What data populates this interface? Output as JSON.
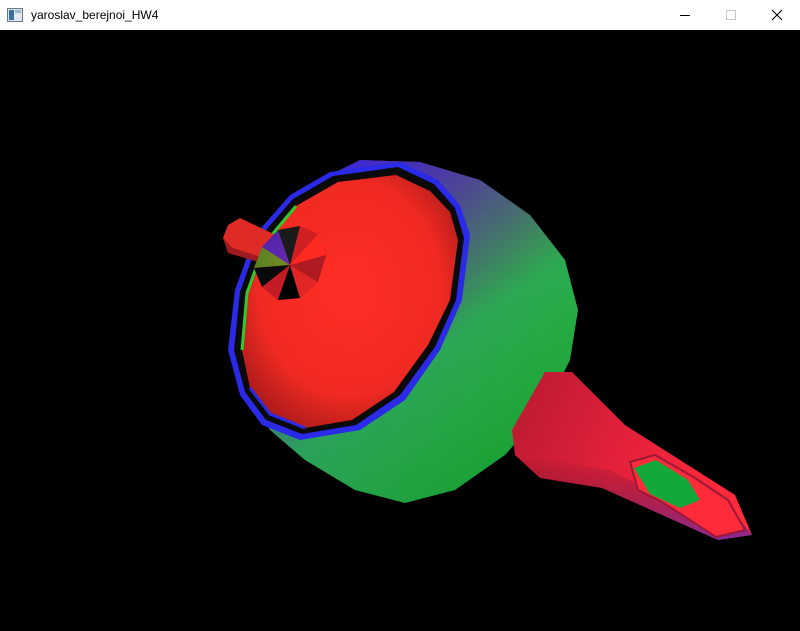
{
  "window": {
    "title": "yaroslav_berejnoi_HW4",
    "app_icon": "window-app-icon",
    "controls": {
      "minimize_icon": "minimize-icon",
      "maximize_icon": "maximize-icon",
      "close_icon": "close-icon"
    }
  },
  "viewport": {
    "background": "#000000",
    "scene_object": "teapot",
    "colors": {
      "red": "#ff2a22",
      "green": "#2ccc2a",
      "blue": "#2a2ae8"
    }
  }
}
